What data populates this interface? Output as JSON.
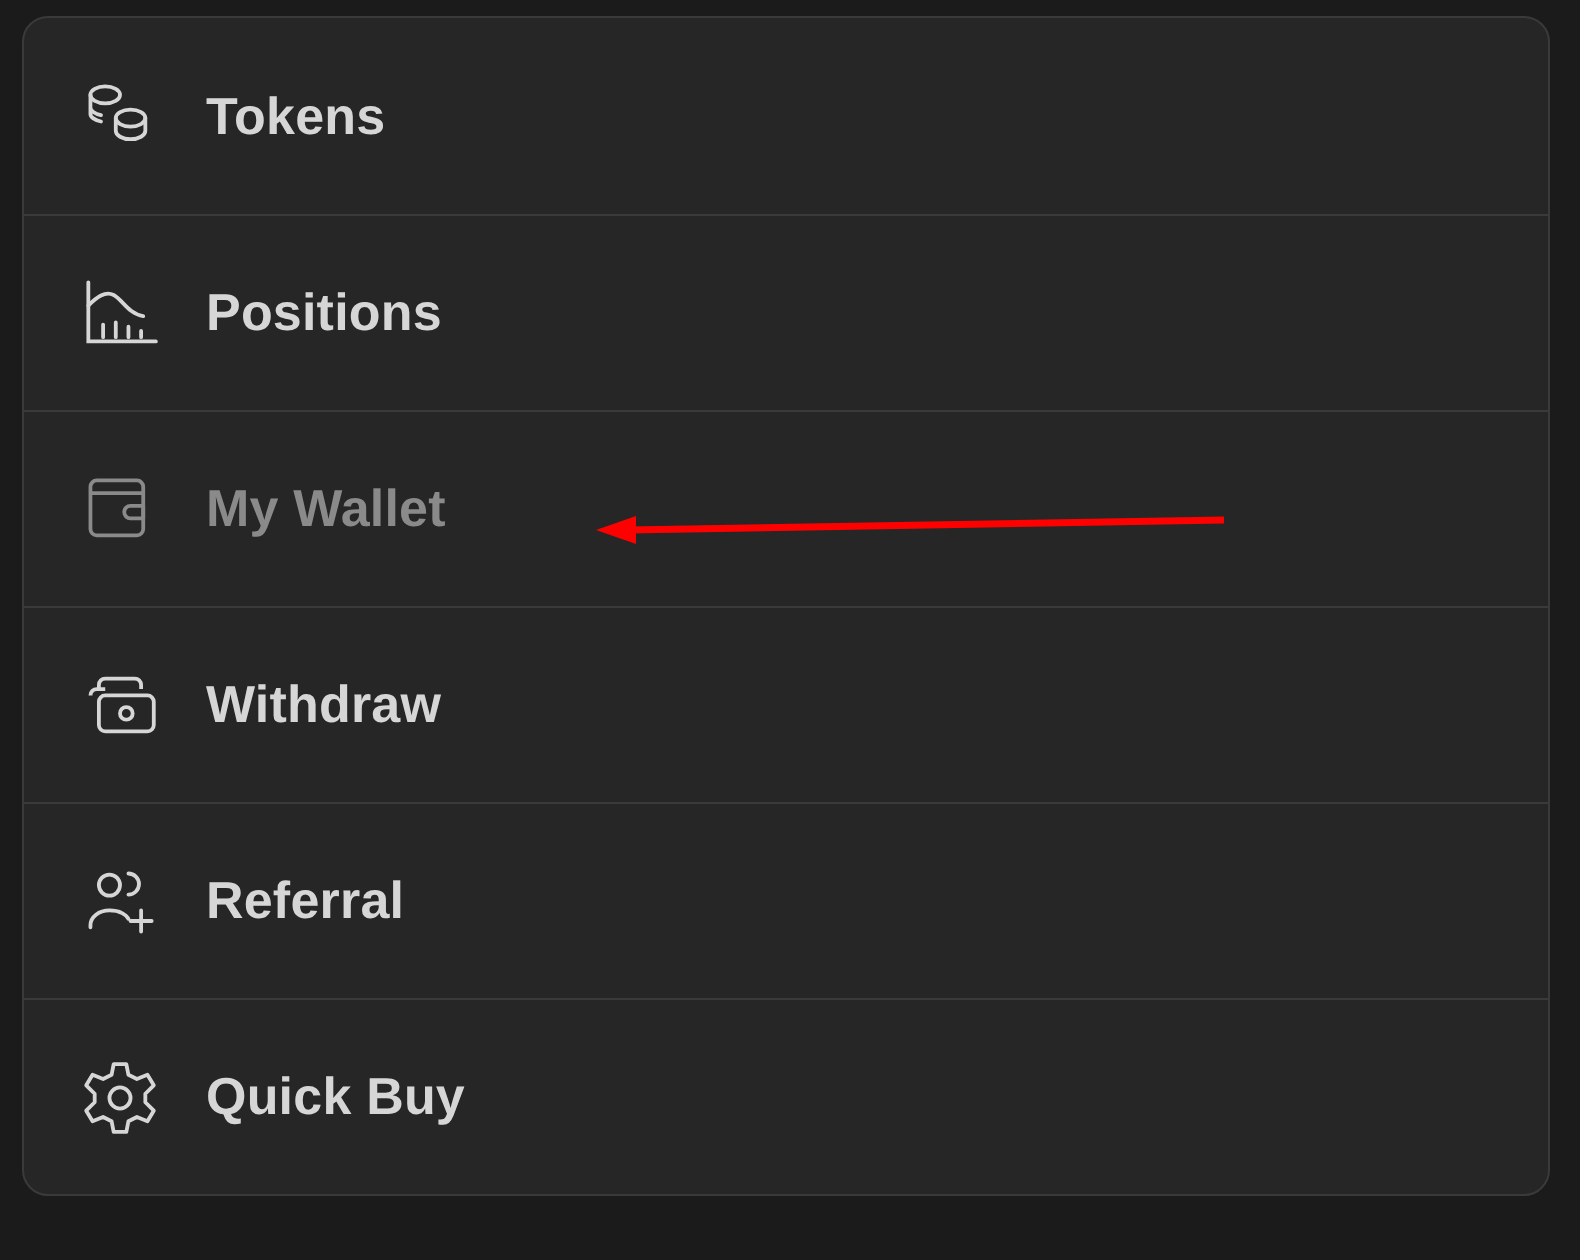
{
  "menu": {
    "items": [
      {
        "label": "Tokens",
        "disabled": false
      },
      {
        "label": "Positions",
        "disabled": false
      },
      {
        "label": "My Wallet",
        "disabled": true
      },
      {
        "label": "Withdraw",
        "disabled": false
      },
      {
        "label": "Referral",
        "disabled": false
      },
      {
        "label": "Quick Buy",
        "disabled": false
      }
    ]
  },
  "annotations": [
    {
      "kind": "arrow"
    }
  ]
}
